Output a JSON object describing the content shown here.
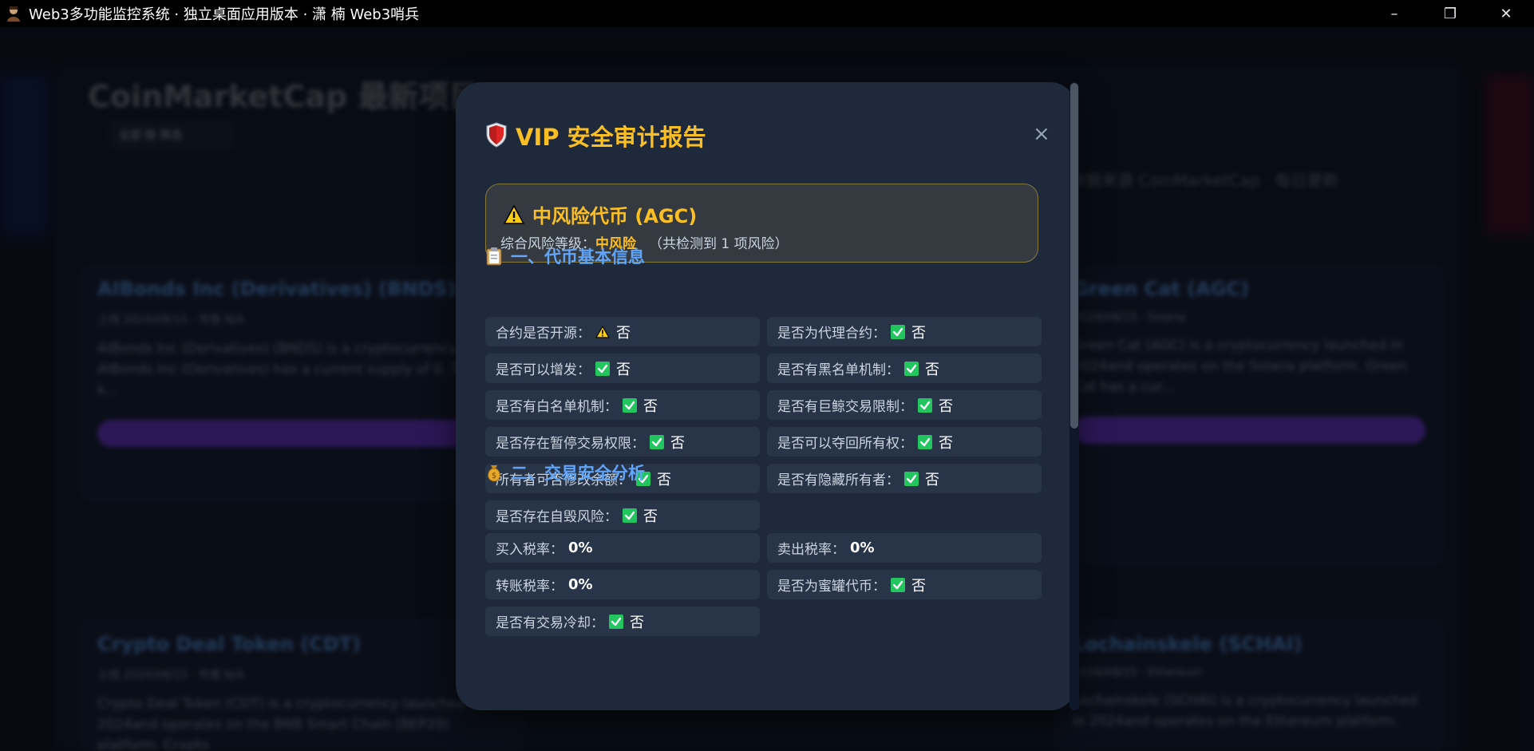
{
  "window": {
    "title": "Web3多功能监控系统 · 独立桌面应用版本 · 潇 楠 Web3哨兵",
    "minimize": "–",
    "maximize": "❐",
    "close": "✕"
  },
  "background": {
    "page_title": "CoinMarketCap 最新项目",
    "filter_label": "全部 链 筛选",
    "note": "数据来源 CoinMarketCap · 每日更新",
    "cards": [
      {
        "title": "AIBonds Inc (Derivatives) (BNDS)",
        "meta": "上线 2024/08/15 · 市值 N/A",
        "desc": "AIBonds Inc (Derivatives) (BNDS) is a cryptocurrency. AIBonds Inc (Derivatives) has a current supply of 0. The last k..."
      },
      {
        "title": "Green Cat (AGC)",
        "meta": "2024/08/15 · Solana",
        "desc": "Green Cat (AGC) is a cryptocurrency launched in 2024and operates on the Solana platform. Green Cat has a cur..."
      },
      {
        "title": "Crypto Deal Token (CDT)",
        "meta": "上线 2024/08/15 · 市值 N/A",
        "desc": "Crypto Deal Token (CDT) is a cryptocurrency launched in 2024and operates on the BNB Smart Chain (BEP20) platform. Crypto"
      },
      {
        "title": "Lochainskele (SCHAI)",
        "meta": "2024/08/15 · Ethereum",
        "desc": "Lochainskele (SCHAI) is a cryptocurrency launched in 2024and operates on the Ethereum platform."
      }
    ]
  },
  "modal": {
    "title": "VIP 安全审计报告",
    "close_label": "×",
    "risk": {
      "title": "中风险代币 (AGC)",
      "level_prefix": "综合风险等级：",
      "level": "中风险",
      "count_text": "（共检测到 1 项风险）"
    },
    "section1": {
      "title": "一、代币基本信息",
      "icon": "clipboard-icon",
      "items": [
        {
          "label": "合约是否开源：",
          "status": "warning",
          "value": "否"
        },
        {
          "label": "是否为代理合约：",
          "status": "check",
          "value": "否"
        },
        {
          "label": "是否可以增发：",
          "status": "check",
          "value": "否"
        },
        {
          "label": "是否有黑名单机制：",
          "status": "check",
          "value": "否"
        },
        {
          "label": "是否有白名单机制：",
          "status": "check",
          "value": "否"
        },
        {
          "label": "是否有巨鲸交易限制：",
          "status": "check",
          "value": "否"
        },
        {
          "label": "是否存在暂停交易权限：",
          "status": "check",
          "value": "否"
        },
        {
          "label": "是否可以夺回所有权：",
          "status": "check",
          "value": "否"
        },
        {
          "label": "所有者可否修改余额：",
          "status": "check",
          "value": "否"
        },
        {
          "label": "是否有隐藏所有者：",
          "status": "check",
          "value": "否"
        },
        {
          "label": "是否存在自毁风险：",
          "status": "check",
          "value": "否"
        }
      ]
    },
    "section2": {
      "title": "二、交易安全分析",
      "icon": "money-bag-icon",
      "items": [
        {
          "label": "买入税率：",
          "status": "none",
          "value": "0%"
        },
        {
          "label": "卖出税率：",
          "status": "none",
          "value": "0%"
        },
        {
          "label": "转账税率：",
          "status": "none",
          "value": "0%"
        },
        {
          "label": "是否为蜜罐代币：",
          "status": "check",
          "value": "否"
        },
        {
          "label": "是否有交易冷却：",
          "status": "check",
          "value": "否"
        }
      ]
    },
    "colors": {
      "accent_yellow": "#fbbf24",
      "section_blue": "#60a5fa",
      "check_green": "#22c55e",
      "modal_bg": "#1e293b"
    }
  }
}
